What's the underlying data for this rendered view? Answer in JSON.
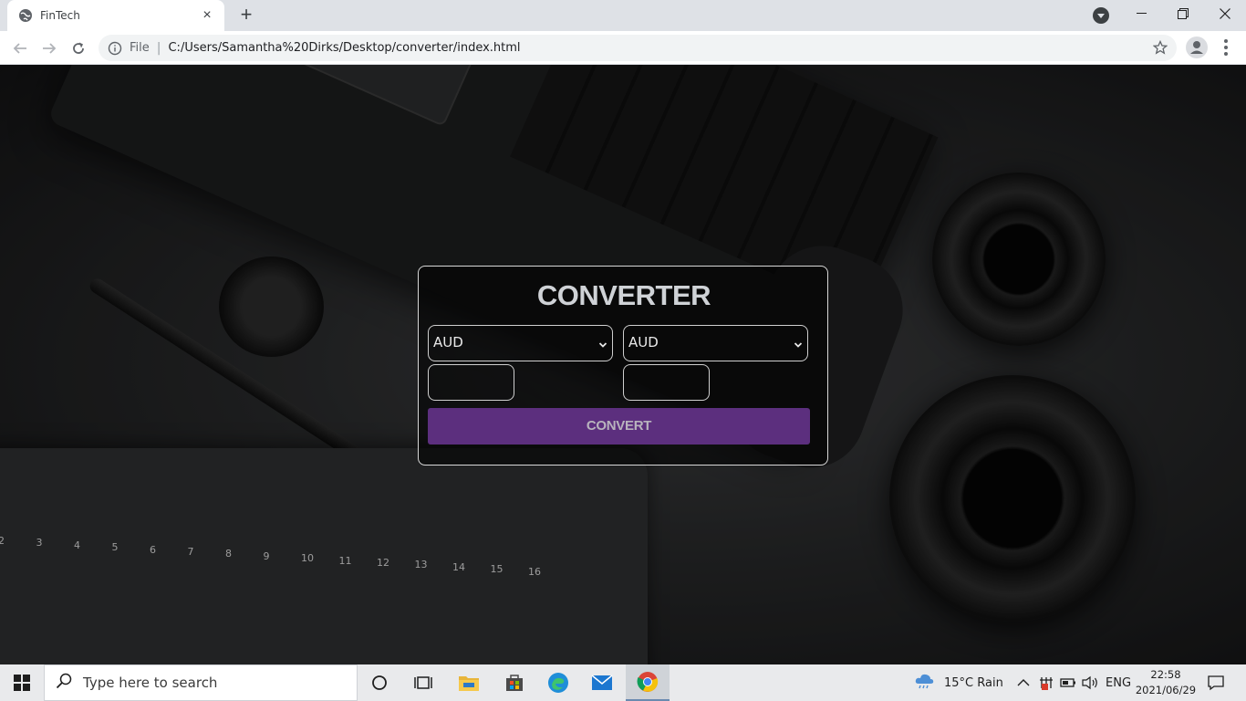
{
  "browser": {
    "tab_title": "FinTech",
    "tab_close": "×",
    "new_tab": "+",
    "address_scheme": "File",
    "address_url": "C:/Users/Samantha%20Dirks/Desktop/converter/index.html"
  },
  "converter": {
    "heading": "CONVERTER",
    "from_currency": "AUD",
    "to_currency": "AUD",
    "from_amount": "",
    "to_amount": "",
    "convert_label": "CONVERT"
  },
  "background": {
    "ruler_numbers": [
      "2",
      "3",
      "4",
      "5",
      "6",
      "7",
      "8",
      "9",
      "10",
      "11",
      "12",
      "13",
      "14",
      "15",
      "16"
    ]
  },
  "taskbar": {
    "search_placeholder": "Type here to search",
    "weather": "15°C  Rain",
    "language": "ENG",
    "time": "22:58",
    "date": "2021/06/29",
    "pinned_icons": [
      "cortana-icon",
      "task-view-icon",
      "file-explorer-icon",
      "store-icon",
      "edge-icon",
      "mail-icon",
      "chrome-icon"
    ]
  },
  "colors": {
    "convert_button": "#5c2f7e",
    "card_border": "#d8d8d8"
  }
}
